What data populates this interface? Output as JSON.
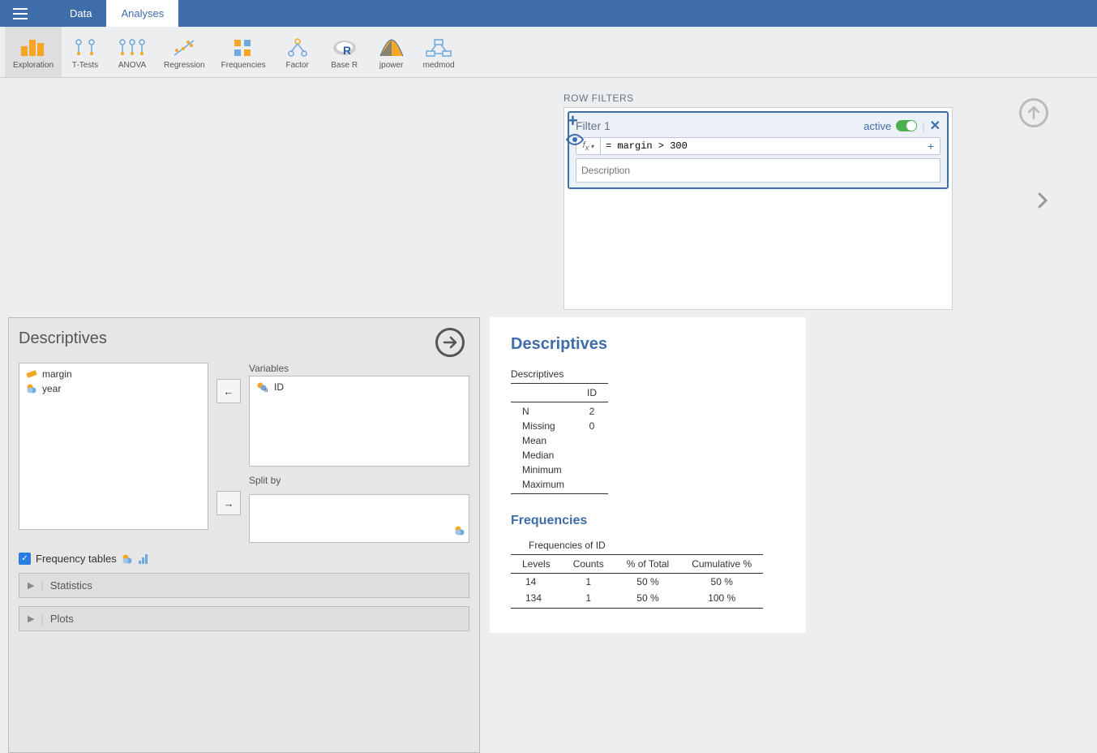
{
  "tabs": {
    "data": "Data",
    "analyses": "Analyses"
  },
  "ribbon": {
    "exploration": "Exploration",
    "ttests": "T-Tests",
    "anova": "ANOVA",
    "regression": "Regression",
    "frequencies": "Frequencies",
    "factor": "Factor",
    "baseR": "Base R",
    "jpower": "jpower",
    "medmod": "medmod"
  },
  "filters": {
    "title": "ROW FILTERS",
    "filter1": {
      "name": "Filter 1",
      "active_label": "active",
      "formula": "= margin > 300",
      "desc_placeholder": "Description"
    },
    "fx_label": "fx ▾"
  },
  "options": {
    "title": "Descriptives",
    "source_vars": [
      {
        "name": "margin",
        "type": "continuous"
      },
      {
        "name": "year",
        "type": "nominal"
      }
    ],
    "variables_label": "Variables",
    "variables": [
      {
        "name": "ID",
        "type": "nominal-text"
      }
    ],
    "splitby_label": "Split by",
    "freq_label": "Frequency tables",
    "statistics_label": "Statistics",
    "plots_label": "Plots"
  },
  "results": {
    "desc_title": "Descriptives",
    "desc_table_title": "Descriptives",
    "desc_header": "ID",
    "desc_rows": [
      {
        "label": "N",
        "value": "2"
      },
      {
        "label": "Missing",
        "value": "0"
      },
      {
        "label": "Mean",
        "value": ""
      },
      {
        "label": "Median",
        "value": ""
      },
      {
        "label": "Minimum",
        "value": ""
      },
      {
        "label": "Maximum",
        "value": ""
      }
    ],
    "freq_title": "Frequencies",
    "freq_table_title": "Frequencies of ID",
    "freq_headers": {
      "levels": "Levels",
      "counts": "Counts",
      "pct": "% of Total",
      "cum": "Cumulative %"
    },
    "freq_rows": [
      {
        "level": "14",
        "count": "1",
        "pct": "50 %",
        "cum": "50 %"
      },
      {
        "level": "134",
        "count": "1",
        "pct": "50 %",
        "cum": "100 %"
      }
    ]
  }
}
